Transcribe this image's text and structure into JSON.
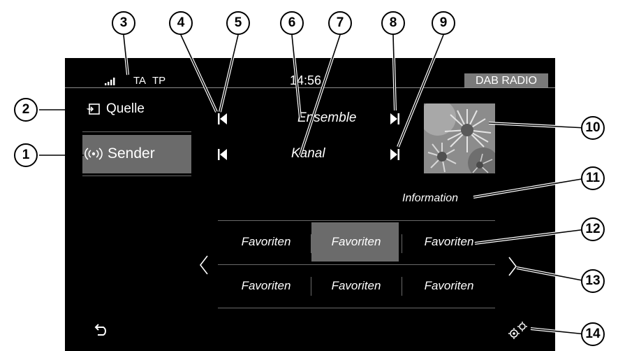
{
  "status": {
    "ta": "TA",
    "tp": "TP",
    "time": "14:56",
    "mode_badge": "DAB RADIO"
  },
  "sidebar": {
    "source_label": "Quelle",
    "station_label": "Sender"
  },
  "tuner": {
    "ensemble": "Ensemble",
    "channel": "Kanal",
    "information": "Information"
  },
  "favorites": {
    "row1": [
      "Favoriten",
      "Favoriten",
      "Favoriten"
    ],
    "row2": [
      "Favoriten",
      "Favoriten",
      "Favoriten"
    ]
  },
  "callouts": [
    "1",
    "2",
    "3",
    "4",
    "5",
    "6",
    "7",
    "8",
    "9",
    "10",
    "11",
    "12",
    "13",
    "14"
  ],
  "colors": {
    "screen_bg": "#000000",
    "highlight": "#6b6b6b",
    "badge_bg": "#7a7a7a",
    "divider": "#6a6a6a"
  }
}
